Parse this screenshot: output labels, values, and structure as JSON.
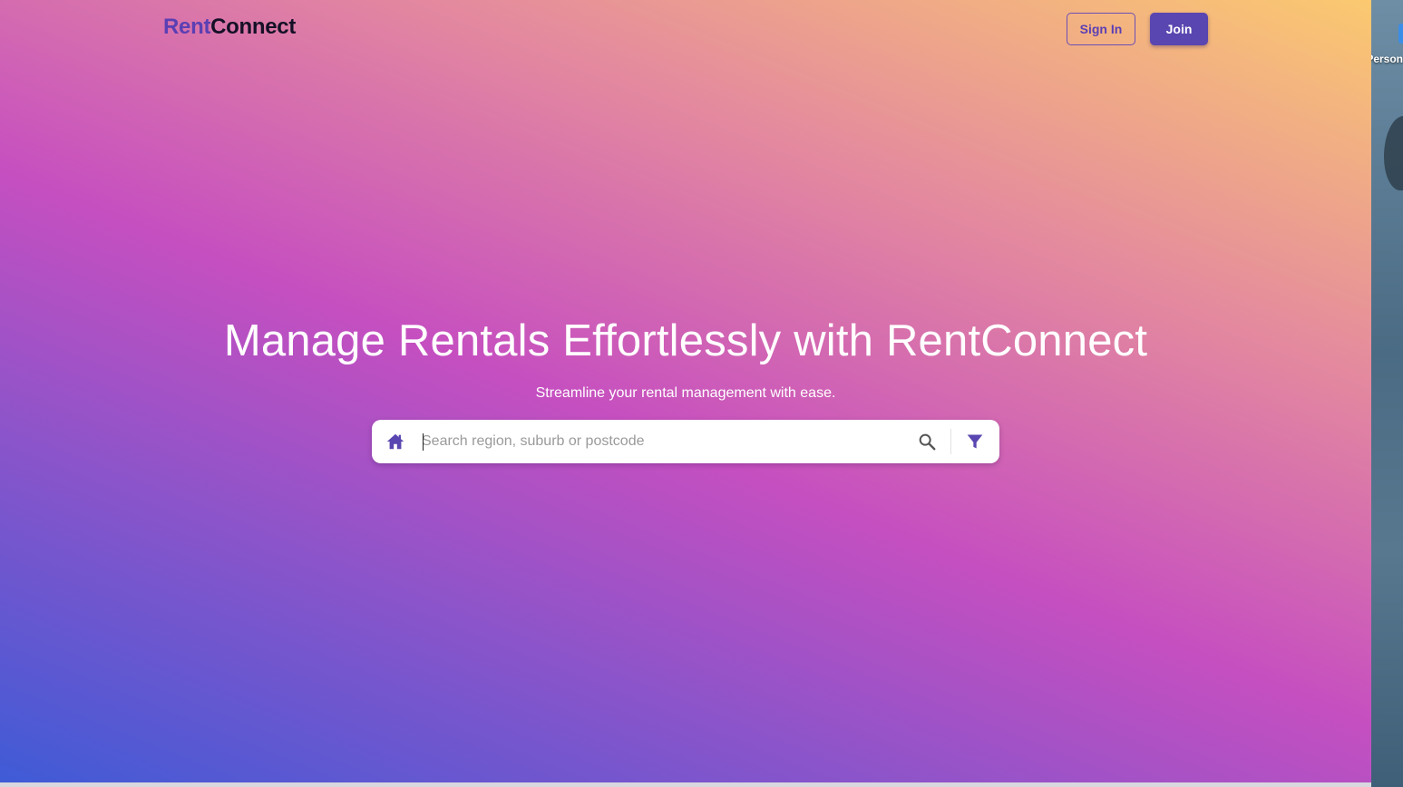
{
  "header": {
    "logo_part1": "Rent",
    "logo_part2": "Connect",
    "sign_in_label": "Sign In",
    "join_label": "Join"
  },
  "hero": {
    "title": "Manage Rentals Effortlessly with RentConnect",
    "subtitle": "Streamline your rental management with ease."
  },
  "search": {
    "placeholder": "Search region, suburb or postcode",
    "value": "",
    "leading_icon": "home-icon",
    "action_icon": "search-icon",
    "filter_icon": "filter-icon"
  },
  "desktop": {
    "icon_label": "Person"
  },
  "colors": {
    "brand_primary": "#5a46b0",
    "logo_rent": "#5b3fb3",
    "logo_connect": "#151027",
    "gradient_start": "#3f5bd6",
    "gradient_mid": "#c64fc0",
    "gradient_end": "#fbc970"
  }
}
